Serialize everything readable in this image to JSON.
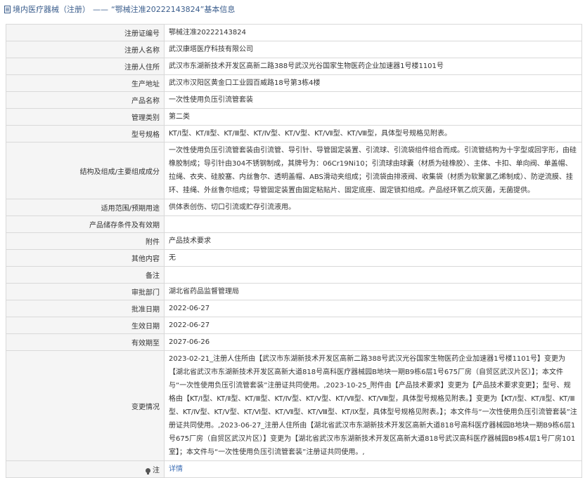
{
  "header": {
    "prefix": "境内医疗器械（注册）",
    "sep": "——",
    "title": "“鄂械注准20222143824”基本信息"
  },
  "rows": [
    {
      "label": "注册证编号",
      "value": "鄂械注准20222143824"
    },
    {
      "label": "注册人名称",
      "value": "武汉康塔医疗科技有限公司"
    },
    {
      "label": "注册人住所",
      "value": "武汉市东湖新技术开发区高新二路388号武汉光谷国家生物医药企业加速器1号楼1101号"
    },
    {
      "label": "生产地址",
      "value": "武汉市汉阳区黄金口工业园百威路18号第3栋4楼"
    },
    {
      "label": "产品名称",
      "value": "一次性使用负压引流管套装"
    },
    {
      "label": "管理类别",
      "value": "第二类"
    },
    {
      "label": "型号规格",
      "value": "KT/Ⅰ型、KT/Ⅱ型、KT/Ⅲ型、KT/Ⅳ型、KT/Ⅴ型、KT/Ⅶ型、KT/Ⅷ型，具体型号规格见附表。"
    },
    {
      "label": "结构及组成/主要组成成分",
      "value": "一次性使用负压引流管套装由引流管、导引针、导管固定装置、引流球、引流袋组件组合而成。引流管结构为十字型或回字形，由硅橡胶制成；导引针由304不锈钢制成，其牌号为：06Cr19Ni10；引流球由球囊（材质为硅橡胶）、主体、卡扣、单向阀、单盖帽、拉绳、衣夹、硅胶塞、内丝鲁尔、透明盖帽、ABS滑动夹组成；引流袋由排液阀、收集袋（材质为软聚氯乙烯制成）、防逆流膜、挂环、挂绳、外丝鲁尔组成；导管固定装置由固定粘贴片、固定底座、固定锁扣组成。产品经环氧乙烷灭菌，无菌提供。"
    },
    {
      "label": "适用范围/预期用途",
      "value": "供体表创伤、切口引流或贮存引流液用。"
    },
    {
      "label": "产品储存条件及有效期",
      "value": ""
    },
    {
      "label": "附件",
      "value": "产品技术要求"
    },
    {
      "label": "其他内容",
      "value": "无"
    },
    {
      "label": "备注",
      "value": ""
    },
    {
      "label": "审批部门",
      "value": "湖北省药品监督管理局"
    },
    {
      "label": "批准日期",
      "value": "2022-06-27"
    },
    {
      "label": "生效日期",
      "value": "2022-06-27"
    },
    {
      "label": "有效期至",
      "value": "2027-06-26"
    },
    {
      "label": "变更情况",
      "value": "2023-02-21_注册人住所由【武汉市东湖新技术开发区高新二路388号武汉光谷国家生物医药企业加速器1号楼1101号】变更为【湖北省武汉市东湖新技术开发区高新大道818号高科医疗器械园B地块一期B9栋6层1号675厂房（自贸区武汉片区）】；本文件与“一次性使用负压引流管套装”注册证共同使用。,2023-10-25_附件由【产品技术要求】变更为【产品技术要求变更】；型号、规格由【KT/Ⅰ型、KT/Ⅱ型、KT/Ⅲ型、KT/Ⅳ型、KT/Ⅴ型、KT/Ⅶ型、KT/Ⅷ型，具体型号规格见附表。】变更为【KT/Ⅰ型、KT/Ⅱ型、KT/Ⅲ型、KT/Ⅳ型、KT/Ⅴ型、KT/Ⅵ型、KT/Ⅶ型、KT/Ⅷ型、KT/Ⅸ型，具体型号规格见附表。】；本文件与“一次性使用负压引流管套装”注册证共同使用。,2023-06-27_注册人住所由【湖北省武汉市东湖新技术开发区高新大道818号高科医疗器械园B地块一期B9栋6层1号675厂房（自贸区武汉片区）】变更为【湖北省武汉市东湖新技术开发区高新大道818号武汉高科医疗器械园B9栋4层1号厂房101室】；本文件与“一次性使用负压引流管套装”注册证共同使用。,"
    }
  ],
  "footer": {
    "label": "注",
    "value": "详情"
  }
}
